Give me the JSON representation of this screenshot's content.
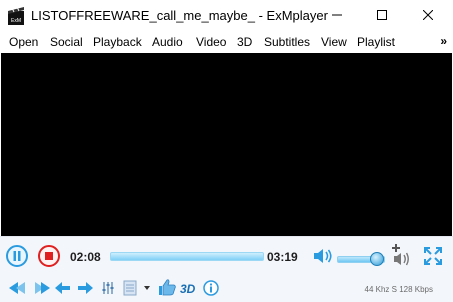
{
  "window": {
    "title": "LISTOFFREEWARE_call_me_maybe_ - ExMplayer",
    "app_icon_text": "ExM"
  },
  "menu": {
    "items": [
      "Open",
      "Social",
      "Playback",
      "Audio",
      "Video",
      "3D",
      "Subtitles",
      "View",
      "Playlist"
    ],
    "more": "»"
  },
  "player": {
    "elapsed": "02:08",
    "total": "03:19",
    "label_3d": "3D",
    "status": "44 Khz S 128 Kbps",
    "seek_progress": 0.0,
    "volume_level": 0.85
  },
  "colors": {
    "accent": "#2b9be0",
    "stop_red": "#e02020",
    "video_bg": "#000000"
  }
}
